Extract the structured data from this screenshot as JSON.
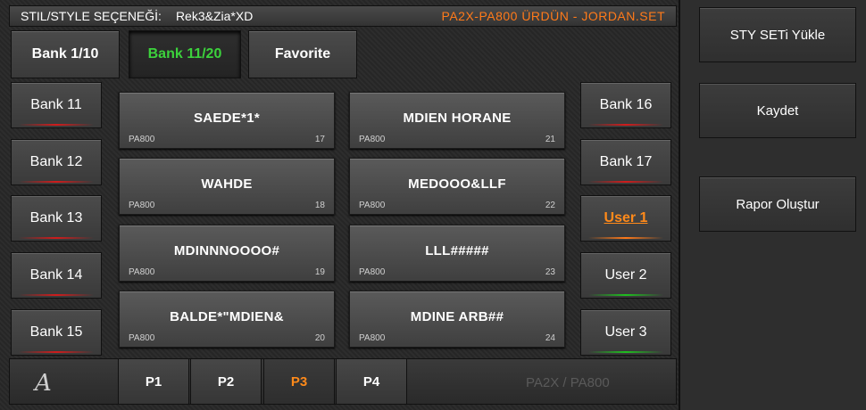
{
  "titlebar": {
    "label": "STIL/STYLE SEÇENEĞİ:",
    "value": "Rek3&Zia*XD",
    "right_text": "PA2X-PA800 ÜRDÜN - JORDAN.SET"
  },
  "bank_tabs": [
    {
      "label": "Bank 1/10",
      "active": false
    },
    {
      "label": "Bank 11/20",
      "active": true
    },
    {
      "label": "Favorite",
      "active": false
    }
  ],
  "left_banks": [
    "Bank 11",
    "Bank 12",
    "Bank 13",
    "Bank 14",
    "Bank 15"
  ],
  "right_banks": [
    {
      "label": "Bank 16",
      "accent": "red"
    },
    {
      "label": "Bank 17",
      "accent": "red"
    },
    {
      "label": "User 1",
      "accent": "orange",
      "selected": true
    },
    {
      "label": "User 2",
      "accent": "green"
    },
    {
      "label": "User 3",
      "accent": "green"
    }
  ],
  "styles": [
    {
      "name": "SAEDE*1*",
      "model": "PA800",
      "num": "17"
    },
    {
      "name": "MDIEN HORANE",
      "model": "PA800",
      "num": "21"
    },
    {
      "name": "WAHDE",
      "model": "PA800",
      "num": "18"
    },
    {
      "name": "MEDOOO&LLF",
      "model": "PA800",
      "num": "22"
    },
    {
      "name": "MDINNNOOOO#",
      "model": "PA800",
      "num": "19"
    },
    {
      "name": "LLL#####",
      "model": "PA800",
      "num": "23"
    },
    {
      "name": "BALDE*\"MDIEN&",
      "model": "PA800",
      "num": "20"
    },
    {
      "name": "MDINE ARB##",
      "model": "PA800",
      "num": "24"
    }
  ],
  "bottom": {
    "logo": "A",
    "pages": [
      "P1",
      "P2",
      "P3",
      "P4"
    ],
    "active_page": "P3",
    "device_label": "PA2X / PA800"
  },
  "right_panel": {
    "load_label": "STY  SETi  Yükle",
    "save_label": "Kaydet",
    "report_label": "Rapor Oluştur"
  },
  "colors": {
    "accent_orange": "#ff7a1a",
    "active_green": "#3cd23c",
    "accent_red": "#d01c1c"
  }
}
